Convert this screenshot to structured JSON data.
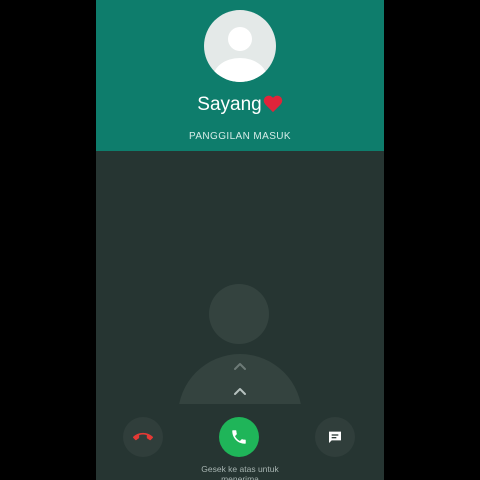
{
  "caller": {
    "name": "Sayang",
    "name_emoji": "heart-icon",
    "status": "PANGGILAN MASUK"
  },
  "actions": {
    "decline": "phone-hangup-icon",
    "accept": "phone-icon",
    "message": "message-icon"
  },
  "hint": {
    "line1": "Gesek ke atas untuk",
    "line2": "menerima"
  },
  "colors": {
    "header": "#0e7d6c",
    "background": "#263532",
    "accept": "#1fb559",
    "decline_icon": "#e53935"
  }
}
